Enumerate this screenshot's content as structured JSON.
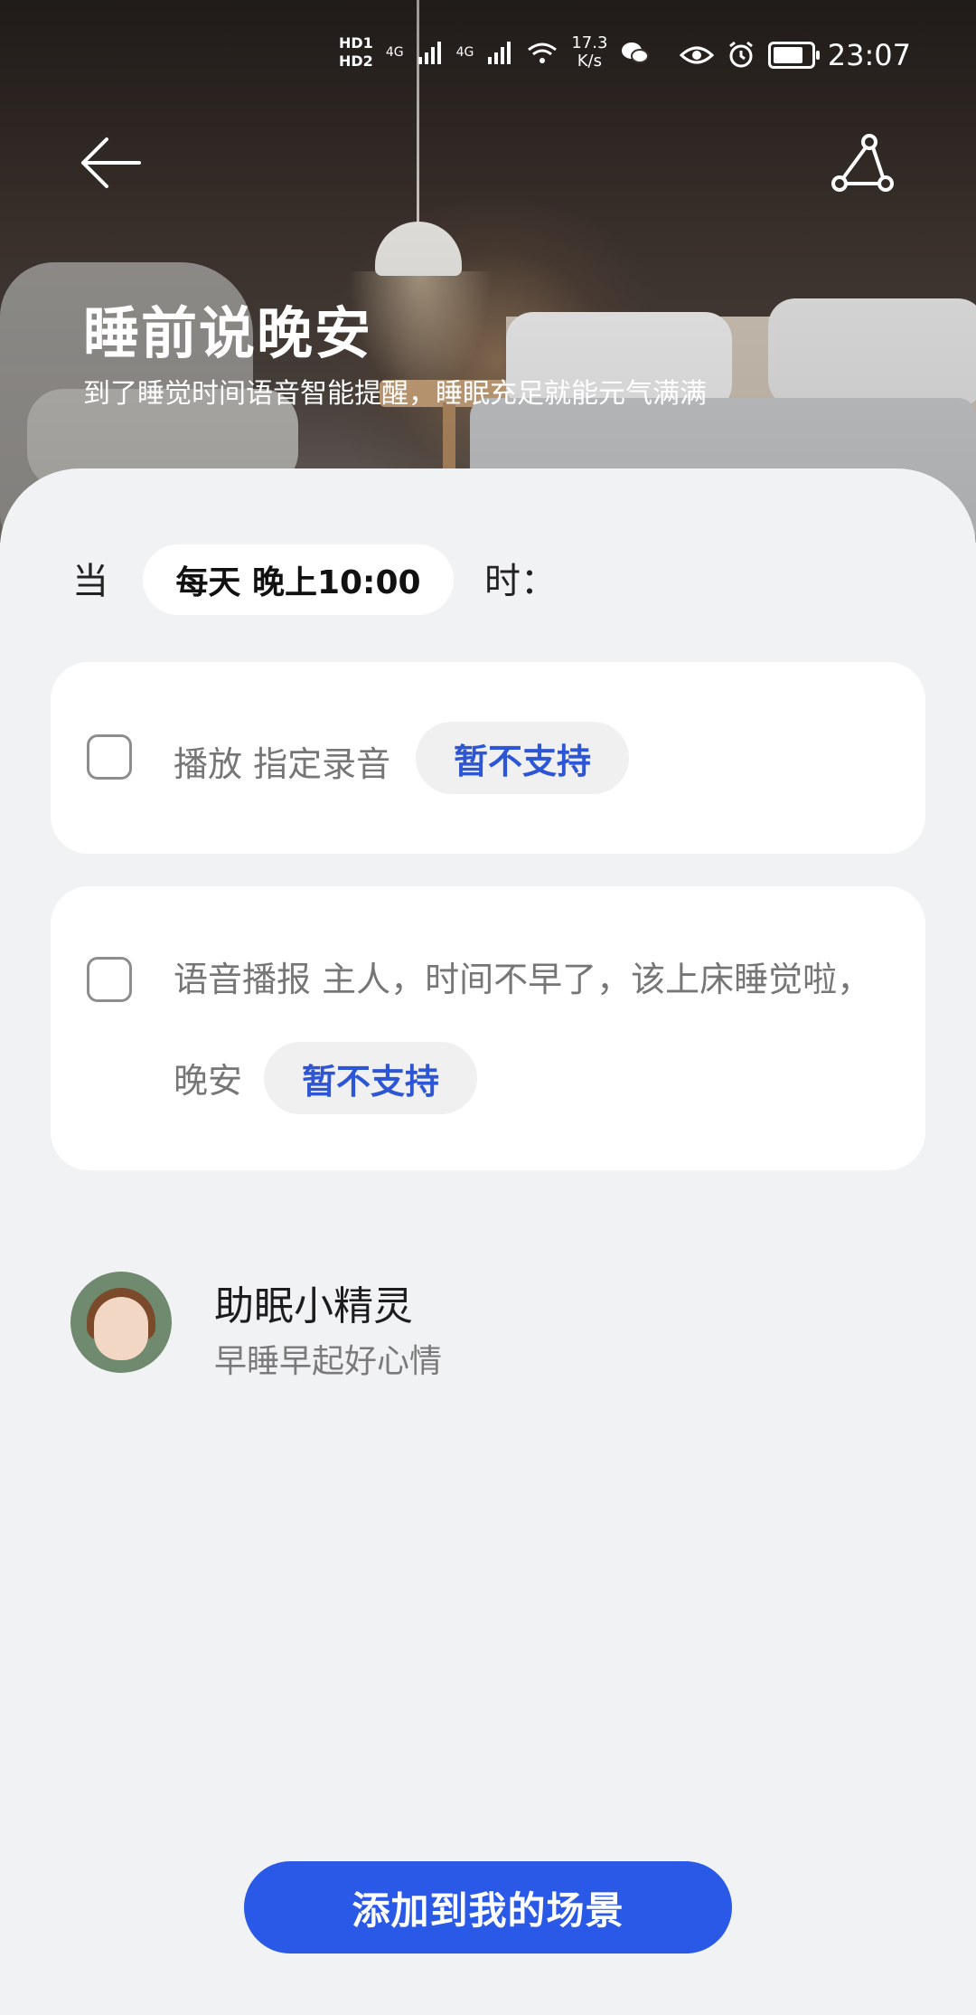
{
  "status_bar": {
    "sim1": "HD1",
    "sim2": "HD2",
    "net1": "4G",
    "net2": "4G",
    "speed_value": "17.3",
    "speed_unit": "K/s",
    "time": "23:07",
    "icons": [
      "signal-icon",
      "wifi-icon",
      "wechat-icon",
      "eye-icon",
      "alarm-icon",
      "battery-icon"
    ]
  },
  "header": {
    "title": "睡前说晚安",
    "subtitle": "到了睡觉时间语音智能提醒，睡眠充足就能元气满满"
  },
  "trigger": {
    "prefix": "当",
    "value": "每天 晚上10:00",
    "suffix": "时："
  },
  "actions": [
    {
      "text": "播放 指定录音",
      "badge": "暂不支持",
      "checked": false
    },
    {
      "text_line1": "语音播报 主人，时间不早了，该上床睡觉啦，",
      "text_line2": "晚安",
      "badge": "暂不支持",
      "checked": false
    }
  ],
  "author": {
    "name": "助眠小精灵",
    "description": "早睡早起好心情"
  },
  "add_button": {
    "label": "添加到我的场景"
  },
  "colors": {
    "accent": "#2a59e8",
    "badge_text": "#2d56d6",
    "background": "#f1f2f4"
  }
}
